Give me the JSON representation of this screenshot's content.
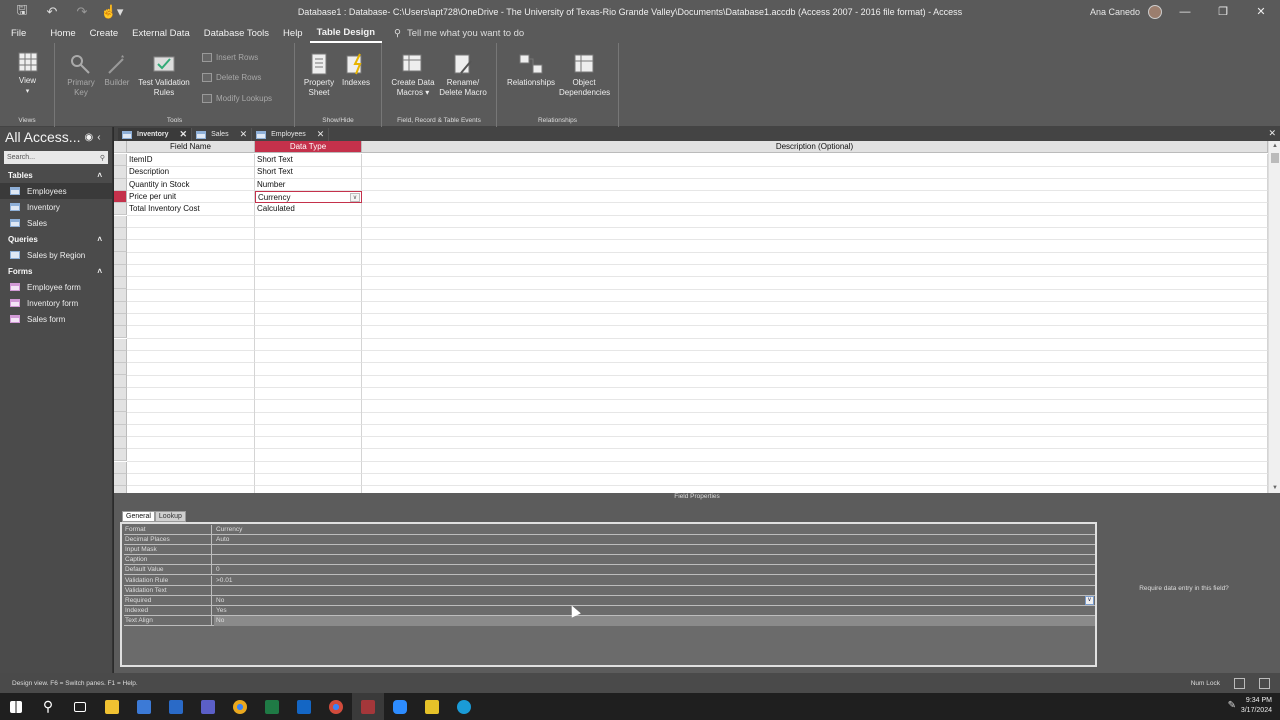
{
  "window": {
    "title": "Database1 : Database- C:\\Users\\apt728\\OneDrive - The University of Texas-Rio Grande Valley\\Documents\\Database1.accdb (Access 2007 - 2016 file format)  -  Access",
    "user": "Ana Canedo",
    "controls": [
      "—",
      "❐",
      "✕"
    ]
  },
  "menu": {
    "tabs": [
      "File",
      "Home",
      "Create",
      "External Data",
      "Database Tools",
      "Help",
      "Table Design"
    ],
    "active": "Table Design",
    "tell_me": "Tell me what you want to do"
  },
  "ribbon": {
    "views": {
      "view_label": "View",
      "group": "Views"
    },
    "tools": {
      "primary_key": "Primary Key",
      "builder": "Builder",
      "test_validation": "Test Validation Rules",
      "insert_rows": "Insert Rows",
      "delete_rows": "Delete Rows",
      "modify_lookups": "Modify Lookups",
      "group": "Tools"
    },
    "showhide": {
      "property_sheet": "Property Sheet",
      "indexes": "Indexes",
      "group": "Show/Hide"
    },
    "events": {
      "create_data_macros": "Create Data Macros",
      "rename_delete": "Rename/ Delete Macro",
      "group": "Field, Record & Table Events"
    },
    "relationships": {
      "relationships": "Relationships",
      "object_deps": "Object Dependencies",
      "group": "Relationships"
    }
  },
  "nav": {
    "title": "All Access...",
    "search_placeholder": "Search...",
    "sections": [
      {
        "label": "Tables",
        "items": [
          "Employees",
          "Inventory",
          "Sales"
        ]
      },
      {
        "label": "Queries",
        "items": [
          "Sales by Region"
        ]
      },
      {
        "label": "Forms",
        "items": [
          "Employee form",
          "Inventory form",
          "Sales form"
        ]
      }
    ],
    "selected": "Employees"
  },
  "doc_tabs": [
    "Inventory",
    "Sales",
    "Employees"
  ],
  "active_doc": "Inventory",
  "design": {
    "headers": [
      "Field Name",
      "Data Type",
      "Description (Optional)"
    ],
    "rows": [
      {
        "field": "ItemID",
        "type": "Short Text"
      },
      {
        "field": "Description",
        "type": "Short Text"
      },
      {
        "field": "Quantity in Stock",
        "type": "Number"
      },
      {
        "field": "Price per unit",
        "type": "Currency"
      },
      {
        "field": "Total Inventory Cost",
        "type": "Calculated"
      }
    ],
    "active_row": 3
  },
  "field_properties": {
    "label": "Field Properties",
    "tabs": [
      "General",
      "Lookup"
    ],
    "props": [
      {
        "name": "Format",
        "value": "Currency"
      },
      {
        "name": "Decimal Places",
        "value": "Auto"
      },
      {
        "name": "Input Mask",
        "value": ""
      },
      {
        "name": "Caption",
        "value": ""
      },
      {
        "name": "Default Value",
        "value": "0"
      },
      {
        "name": "Validation Rule",
        "value": ">0.01"
      },
      {
        "name": "Validation Text",
        "value": ""
      },
      {
        "name": "Required",
        "value": "No"
      },
      {
        "name": "Indexed",
        "value": "Yes"
      },
      {
        "name": "Text Align",
        "value": "No"
      }
    ],
    "help": "Require data entry in this field?"
  },
  "status": {
    "left": "Design view.  F6 = Switch panes.  F1 = Help.",
    "numlock": "Num Lock"
  },
  "clock": {
    "time": "9:34 PM",
    "date": "3/17/2024"
  },
  "colors": {
    "accent": "#c4314b",
    "chrome": "#5a5a5a",
    "nav": "#4b4b4b"
  }
}
